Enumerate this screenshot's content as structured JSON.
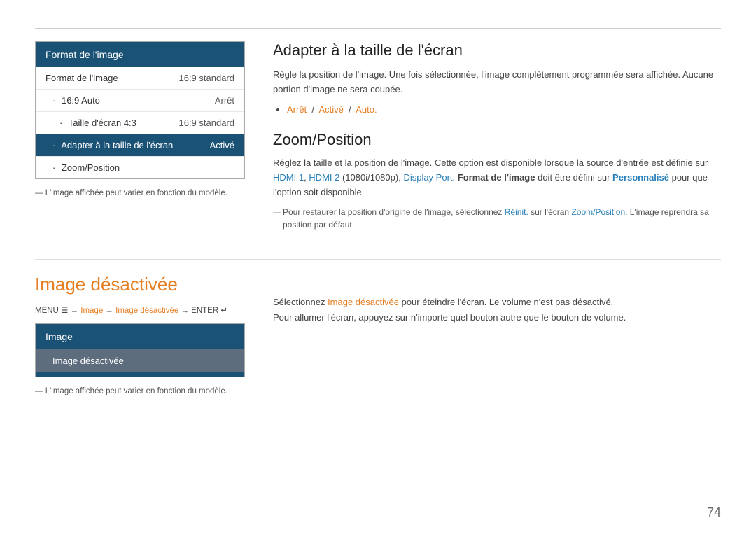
{
  "top_rule": true,
  "left_menu": {
    "header": "Format de l'image",
    "items": [
      {
        "label": "Format de l'image",
        "value": "16:9 standard",
        "level": 0,
        "highlighted": false
      },
      {
        "label": "16:9 Auto",
        "value": "Arrêt",
        "level": 1,
        "highlighted": false
      },
      {
        "label": "Taille d'écran 4:3",
        "value": "16:9 standard",
        "level": 2,
        "highlighted": false
      },
      {
        "label": "Adapter à la taille de l'écran",
        "value": "Activé",
        "level": 1,
        "highlighted": true
      },
      {
        "label": "Zoom/Position",
        "value": "",
        "level": 1,
        "highlighted": false
      }
    ],
    "footer_note": "— L'image affichée peut varier en fonction du modèle."
  },
  "right_content": {
    "adapter_section": {
      "title": "Adapter à la taille de l'écran",
      "body": "Règle la position de l'image. Une fois sélectionnée, l'image complètement programmée sera affichée. Aucune portion d'image ne sera coupée.",
      "bullet": "Arrêt / Activé / Auto."
    },
    "zoom_section": {
      "title": "Zoom/Position",
      "body": "Réglez la taille et la position de l'image. Cette option est disponible lorsque la source d'entrée est définie sur HDMI 1, HDMI 2 (1080i/1080p), Display Port. Format de l'image doit être défini sur Personnalisé pour que l'option soit disponible.",
      "note": "Pour restaurer la position d'origine de l'image, sélectionnez Réinit. sur l'écran Zoom/Position. L'image reprendra sa position par défaut."
    }
  },
  "bottom_left": {
    "title": "Image désactivée",
    "menu_path": "MENU ☰ → Image → Image désactivée → ENTER ↵",
    "menu_header": "Image",
    "menu_item": "Image désactivée",
    "footer_note": "— L'image affichée peut varier en fonction du modèle."
  },
  "bottom_right": {
    "line1": "Sélectionnez Image désactivée pour éteindre l'écran. Le volume n'est pas désactivé.",
    "line2": "Pour allumer l'écran, appuyez sur n'importe quel bouton autre que le bouton de volume."
  },
  "page_number": "74"
}
